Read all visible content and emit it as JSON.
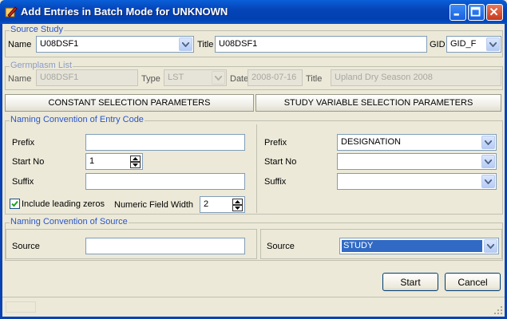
{
  "window": {
    "title": "Add Entries in Batch Mode for UNKNOWN"
  },
  "source_study": {
    "group_title": "Source Study",
    "name_label": "Name",
    "name_value": "U08DSF1",
    "title_label": "Title",
    "title_value": "U08DSF1",
    "gid_label": "GID",
    "gid_value": "GID_F"
  },
  "germplasm_list": {
    "group_title": "Germplasm List",
    "name_label": "Name",
    "name_value": "U08DSF1",
    "type_label": "Type",
    "type_value": "LST",
    "date_label": "Date",
    "date_value": "2008-07-16",
    "title_label": "Title",
    "title_value": "Upland Dry Season 2008"
  },
  "tabs": {
    "constant": "CONSTANT SELECTION PARAMETERS",
    "study_variable": "STUDY VARIABLE SELECTION PARAMETERS"
  },
  "entry_code": {
    "group_title": "Naming Convention of Entry Code",
    "left": {
      "prefix_label": "Prefix",
      "prefix_value": "",
      "start_no_label": "Start No",
      "start_no_value": "1",
      "suffix_label": "Suffix",
      "suffix_value": "",
      "include_zeros_label": "Include leading zeros",
      "include_zeros_checked": true,
      "numeric_width_label": "Numeric Field Width",
      "numeric_width_value": "2"
    },
    "right": {
      "prefix_label": "Prefix",
      "prefix_value": "DESIGNATION",
      "start_no_label": "Start No",
      "start_no_value": "",
      "suffix_label": "Suffix",
      "suffix_value": ""
    }
  },
  "source": {
    "group_title": "Naming Convention of Source",
    "left_label": "Source",
    "left_value": "",
    "right_label": "Source",
    "right_value": "STUDY"
  },
  "buttons": {
    "start": "Start",
    "cancel": "Cancel"
  },
  "colors": {
    "titlebar": "#0544b8",
    "group_title": "#2a56c8",
    "selection": "#316ac5",
    "window_bg": "#ece9d8"
  }
}
